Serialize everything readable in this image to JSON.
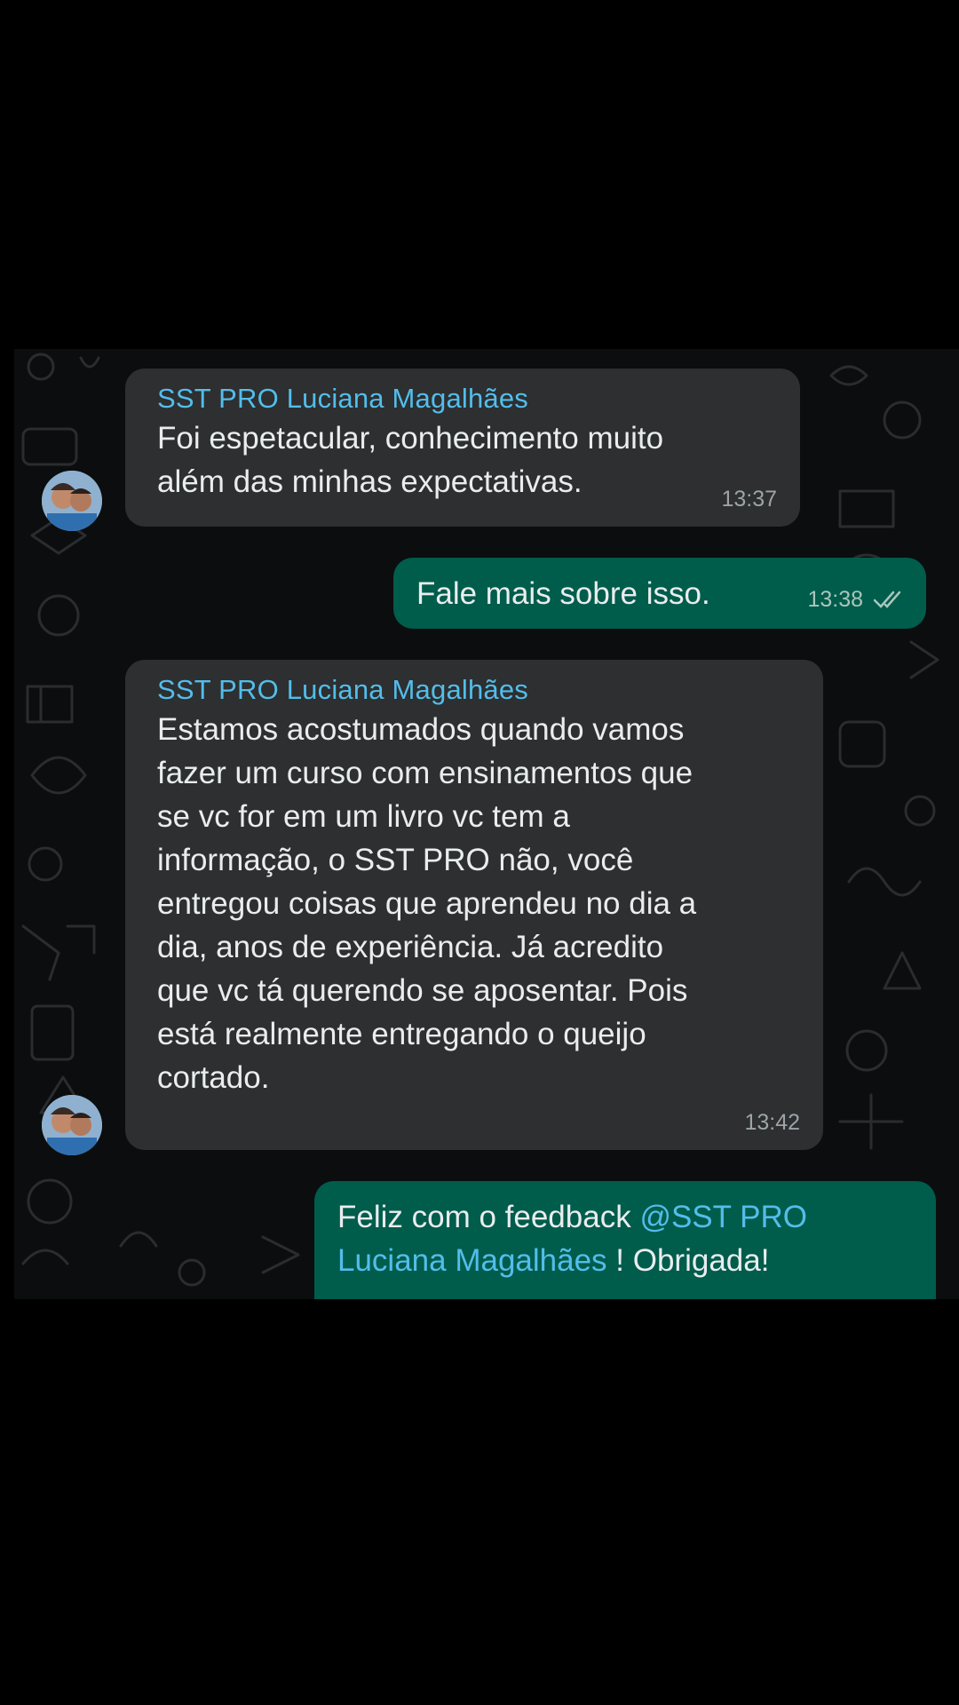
{
  "messages": [
    {
      "sender": "SST PRO Luciana Magalhães",
      "lines": [
        "Foi espetacular,  conhecimento muito",
        "além das minhas expectativas."
      ],
      "time": "13:37"
    },
    {
      "text": "Fale mais sobre isso.",
      "time": "13:38",
      "status": "double-check-icon"
    },
    {
      "sender": "SST PRO Luciana Magalhães",
      "lines": [
        "Estamos acostumados quando vamos",
        "fazer um curso com ensinamentos que",
        "se vc for em um livro vc tem a",
        "informação,  o SST PRO não, você",
        "entregou coisas que aprendeu no dia a",
        "dia, anos de experiência. Já acredito",
        "que vc tá querendo se aposentar.  Pois",
        "está realmente entregando o queijo",
        "cortado."
      ],
      "time": "13:42"
    },
    {
      "line1_prefix": "Feliz com o feedback ",
      "line1_mention": "@SST PRO",
      "line2_mention": "Luciana Magalhães",
      "line2_suffix": " ! Obrigada!"
    }
  ],
  "colors": {
    "incoming_bubble": "#2d2f30",
    "outgoing_bubble": "#005c4b",
    "sender_name": "#53bdeb",
    "timestamp": "#9ba4a8"
  }
}
